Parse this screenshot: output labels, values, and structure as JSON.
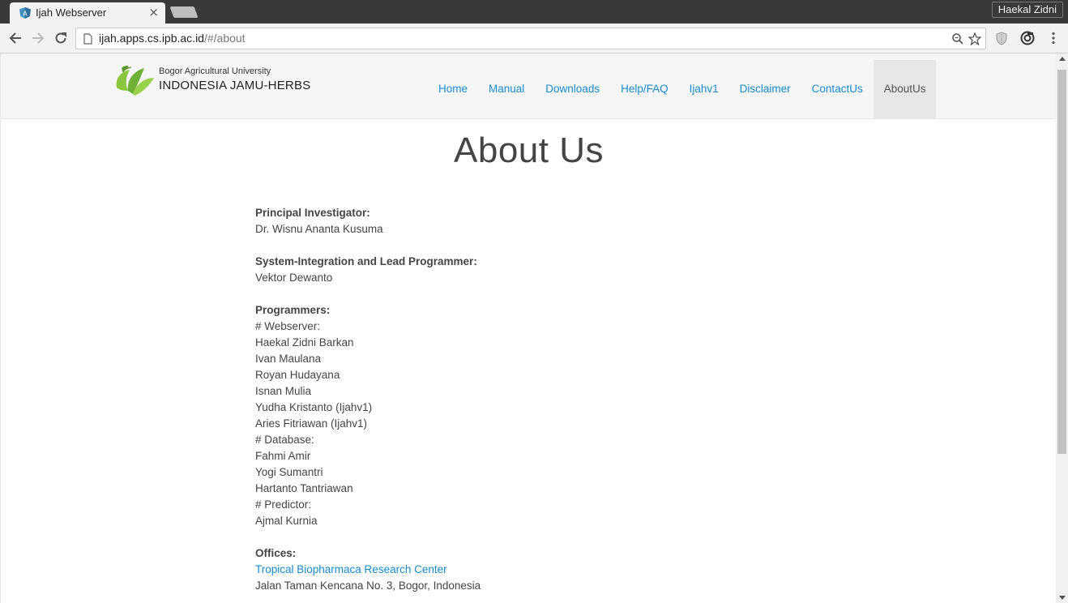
{
  "browser": {
    "tab_title": "Ijah Webserver",
    "tab_close": "×",
    "profile_name": "Haekal Zidni",
    "url_host": "ijah.apps.cs.ipb.ac.id",
    "url_path": "/#/about"
  },
  "header": {
    "logo_subtitle": "Bogor Agricultural University",
    "logo_title": "INDONESIA JAMU-HERBS",
    "nav": [
      "Home",
      "Manual",
      "Downloads",
      "Help/FAQ",
      "Ijahv1",
      "Disclaimer",
      "ContactUs",
      "AboutUs"
    ],
    "active_nav": "AboutUs",
    "brand_color": "#1a8acb",
    "logo_color": "#7dbf3a"
  },
  "main": {
    "title": "About Us",
    "sections": [
      {
        "heading": "Principal Investigator:",
        "lines": [
          "Dr. Wisnu Ananta Kusuma"
        ]
      },
      {
        "heading": "System-Integration and Lead Programmer:",
        "lines": [
          "Vektor Dewanto"
        ]
      },
      {
        "heading": "Programmers:",
        "lines": [
          "# Webserver:",
          "Haekal Zidni Barkan",
          "Ivan Maulana",
          "Royan Hudayana",
          "Isnan Mulia",
          "Yudha Kristanto (Ijahv1)",
          "Aries Fitriawan (Ijahv1)",
          "# Database:",
          "Fahmi Amir",
          "Yogi Sumantri",
          "Hartanto Tantriawan",
          "# Predictor:",
          "Ajmal Kurnia"
        ]
      },
      {
        "heading": "Offices:",
        "link": "Tropical Biopharmaca Research Center",
        "lines": [
          "Jalan Taman Kencana No. 3, Bogor, Indonesia"
        ]
      }
    ]
  }
}
